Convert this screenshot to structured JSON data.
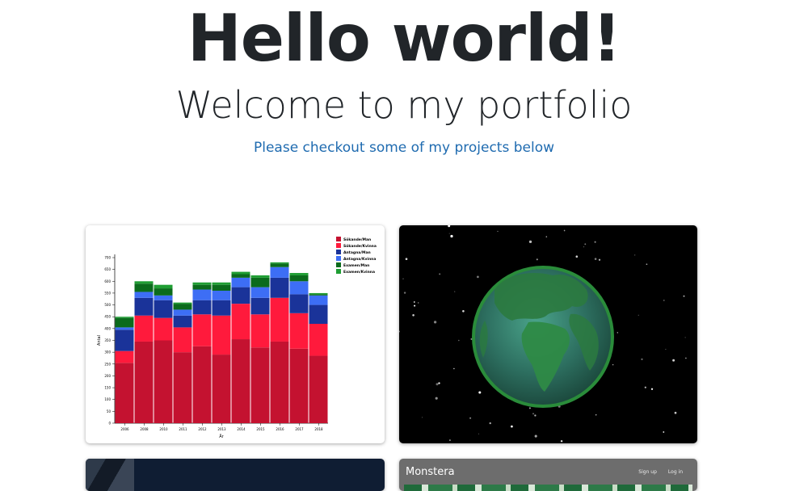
{
  "hero": {
    "title": "Hello world!",
    "subtitle": "Welcome to my portfolio",
    "tagline": "Please checkout some of my projects below"
  },
  "projects": [
    {
      "name": "stacked-bar-chart-project",
      "chart_data": {
        "type": "bar",
        "stacked": true,
        "categories": [
          "2006",
          "2008",
          "2010",
          "2011",
          "2012",
          "2013",
          "2014",
          "2015",
          "2016",
          "2017",
          "2018"
        ],
        "series": [
          {
            "name": "Sökande/Man",
            "color": "#c41230",
            "values": [
              255,
              345,
              350,
              300,
              325,
              290,
              355,
              320,
              345,
              315,
              285
            ]
          },
          {
            "name": "Sökande/Kvinna",
            "color": "#ff1a3c",
            "values": [
              50,
              110,
              95,
              105,
              135,
              165,
              150,
              140,
              185,
              150,
              135
            ]
          },
          {
            "name": "Antagna/Man",
            "color": "#1a3399",
            "values": [
              90,
              75,
              75,
              50,
              60,
              65,
              70,
              70,
              85,
              80,
              80
            ]
          },
          {
            "name": "Antagna/Kvinna",
            "color": "#3d6ef5",
            "values": [
              10,
              25,
              20,
              25,
              45,
              40,
              40,
              45,
              45,
              55,
              40
            ]
          },
          {
            "name": "Examen/Man",
            "color": "#0b6b1c",
            "values": [
              40,
              35,
              30,
              25,
              20,
              25,
              15,
              40,
              15,
              25,
              5
            ]
          },
          {
            "name": "Examen/Kvinna",
            "color": "#1f9e33",
            "values": [
              5,
              10,
              15,
              5,
              10,
              10,
              10,
              10,
              5,
              10,
              5
            ]
          }
        ],
        "title": "",
        "xlabel": "År",
        "ylabel": "Antal",
        "ylim": [
          0,
          700
        ],
        "yticks": [
          0,
          50,
          100,
          150,
          200,
          250,
          300,
          350,
          400,
          450,
          500,
          550,
          600,
          650,
          700
        ],
        "legend": "top-right",
        "grid": false
      }
    },
    {
      "name": "globe-project",
      "icon": "earth-globe-icon"
    },
    {
      "name": "dark-building-project"
    },
    {
      "name": "monstera-project",
      "brand": "Monstera",
      "nav": [
        "Sign up",
        "Log in"
      ]
    }
  ]
}
